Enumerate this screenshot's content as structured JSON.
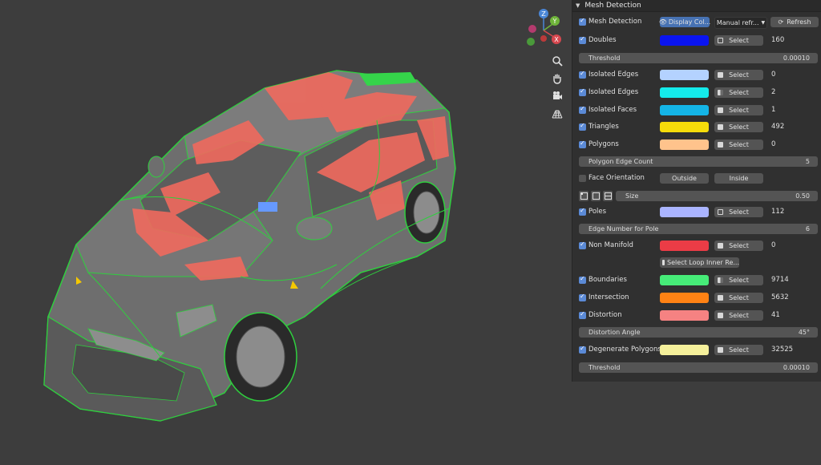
{
  "panel": {
    "title": "Mesh Detection",
    "top": {
      "checkbox_label": "Mesh Detection",
      "display_btn": "Display Col...",
      "manual_select": "Manual refr...",
      "refresh_btn": "Refresh"
    },
    "select_label": "Select",
    "rows": {
      "doubles": {
        "label": "Doubles",
        "color": "#0a14f0",
        "count": "160"
      },
      "threshold1": {
        "label": "Threshold",
        "value": "0.00010"
      },
      "iso_edges1": {
        "label": "Isolated Edges",
        "color": "#b4d2ff",
        "count": "0"
      },
      "iso_edges2": {
        "label": "Isolated Edges",
        "color": "#14ebeb",
        "count": "2"
      },
      "iso_faces": {
        "label": "Isolated Faces",
        "color": "#14b4e6",
        "count": "1"
      },
      "triangles": {
        "label": "Triangles",
        "color": "#f5dc0a",
        "count": "492"
      },
      "polygons": {
        "label": "Polygons",
        "color": "#ffc38c",
        "count": "0"
      },
      "poly_edge_count": {
        "label": "Polygon Edge Count",
        "value": "5"
      },
      "face_orientation": {
        "label": "Face Orientation",
        "outside": "Outside",
        "inside": "Inside"
      },
      "size": {
        "label": "Size",
        "value": "0.50"
      },
      "poles": {
        "label": "Poles",
        "color": "#aab4ff",
        "count": "112"
      },
      "edge_num_pole": {
        "label": "Edge Number for Pole",
        "value": "6"
      },
      "non_manifold": {
        "label": "Non Manifold",
        "color": "#eb3c46",
        "count": "0"
      },
      "select_loop": {
        "label": "Select Loop Inner Re..."
      },
      "boundaries": {
        "label": "Boundaries",
        "color": "#46eb78",
        "count": "9714"
      },
      "intersection": {
        "label": "Intersection",
        "color": "#ff8214",
        "count": "5632"
      },
      "distortion": {
        "label": "Distortion",
        "color": "#f58282",
        "count": "41"
      },
      "distortion_angle": {
        "label": "Distortion Angle",
        "value": "45°"
      },
      "degenerate": {
        "label": "Degenerate Polygons",
        "color": "#f5f09b",
        "count": "32525"
      },
      "threshold2": {
        "label": "Threshold",
        "value": "0.00010"
      }
    }
  },
  "gizmo": {
    "z": "Z",
    "y": "Y",
    "x": "X"
  },
  "viewport_tools": [
    "zoom-icon",
    "hand-icon",
    "camera-icon",
    "grid-icon"
  ]
}
